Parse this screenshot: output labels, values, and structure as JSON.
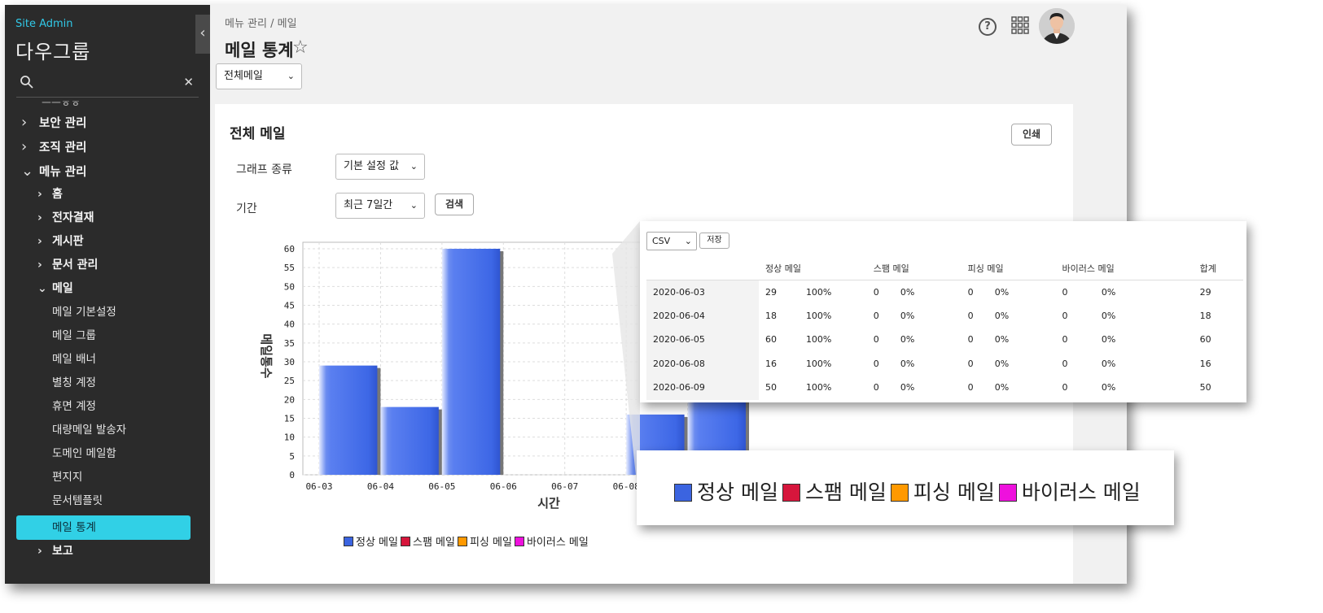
{
  "sidebar": {
    "site_admin": "Site Admin",
    "company": "다우그룹",
    "search": {
      "placeholder": ""
    },
    "cut_item": "ㅡㅡㅎㅎ",
    "items": [
      {
        "label": "보안 관리",
        "chev": "›"
      },
      {
        "label": "조직 관리",
        "chev": "›"
      },
      {
        "label": "메뉴 관리",
        "chev": "⌄"
      },
      {
        "label": "홈",
        "chev": "›"
      },
      {
        "label": "전자결재",
        "chev": "›"
      },
      {
        "label": "게시판",
        "chev": "›"
      },
      {
        "label": "문서 관리",
        "chev": "›"
      },
      {
        "label": "메일",
        "chev": "⌄"
      },
      {
        "label": "메일 기본설정"
      },
      {
        "label": "메일 그룹"
      },
      {
        "label": "메일 배너"
      },
      {
        "label": "별칭 계정"
      },
      {
        "label": "휴면 계정"
      },
      {
        "label": "대량메일 발송자"
      },
      {
        "label": "도메인 메일함"
      },
      {
        "label": "편지지"
      },
      {
        "label": "문서템플릿"
      },
      {
        "label": "메일 통계"
      },
      {
        "label": "보고",
        "chev": "›"
      }
    ]
  },
  "header": {
    "breadcrumb": "메뉴 관리 / 메일",
    "title": "메일 통계",
    "help": "?",
    "mail_filter": "전체메일"
  },
  "panel": {
    "title": "전체 메일",
    "print": "인쇄",
    "graph_type_label": "그래프 종류",
    "graph_type_value": "기본 설정 값",
    "period_label": "기간",
    "period_value": "최근 7일간",
    "search": "검색"
  },
  "chart_data": {
    "type": "bar",
    "categories": [
      "06-03",
      "06-04",
      "06-05",
      "06-06",
      "06-07",
      "06-08",
      "06-09"
    ],
    "series": [
      {
        "name": "정상 메일",
        "color": "#3b64e0",
        "values": [
          29,
          18,
          60,
          0,
          0,
          16,
          50
        ]
      },
      {
        "name": "스팸 메일",
        "color": "#d6163c",
        "values": [
          0,
          0,
          0,
          0,
          0,
          0,
          0
        ]
      },
      {
        "name": "피싱 메일",
        "color": "#ff9900",
        "values": [
          0,
          0,
          0,
          0,
          0,
          0,
          0
        ]
      },
      {
        "name": "바이러스 메일",
        "color": "#ee11dd",
        "values": [
          0,
          0,
          0,
          0,
          0,
          0,
          0
        ]
      }
    ],
    "xlabel": "시간",
    "ylabel": "메일통수",
    "ylim": [
      0,
      60
    ],
    "yticks": [
      "0",
      "5",
      "10",
      "15",
      "20",
      "25",
      "30",
      "35",
      "40",
      "45",
      "50",
      "55",
      "60"
    ],
    "grid": true,
    "legend": "bottom"
  },
  "table": {
    "format": "CSV",
    "save": "저장",
    "headers": [
      "정상 메일",
      "스팸 메일",
      "피싱 메일",
      "바이러스 메일",
      "합계"
    ],
    "rows": [
      [
        "2020-06-03",
        "29",
        "100%",
        "0",
        "0%",
        "0",
        "0%",
        "0",
        "0%",
        "29"
      ],
      [
        "2020-06-04",
        "18",
        "100%",
        "0",
        "0%",
        "0",
        "0%",
        "0",
        "0%",
        "18"
      ],
      [
        "2020-06-05",
        "60",
        "100%",
        "0",
        "0%",
        "0",
        "0%",
        "0",
        "0%",
        "60"
      ],
      [
        "2020-06-08",
        "16",
        "100%",
        "0",
        "0%",
        "0",
        "0%",
        "0",
        "0%",
        "16"
      ],
      [
        "2020-06-09",
        "50",
        "100%",
        "0",
        "0%",
        "0",
        "0%",
        "0",
        "0%",
        "50"
      ]
    ]
  }
}
